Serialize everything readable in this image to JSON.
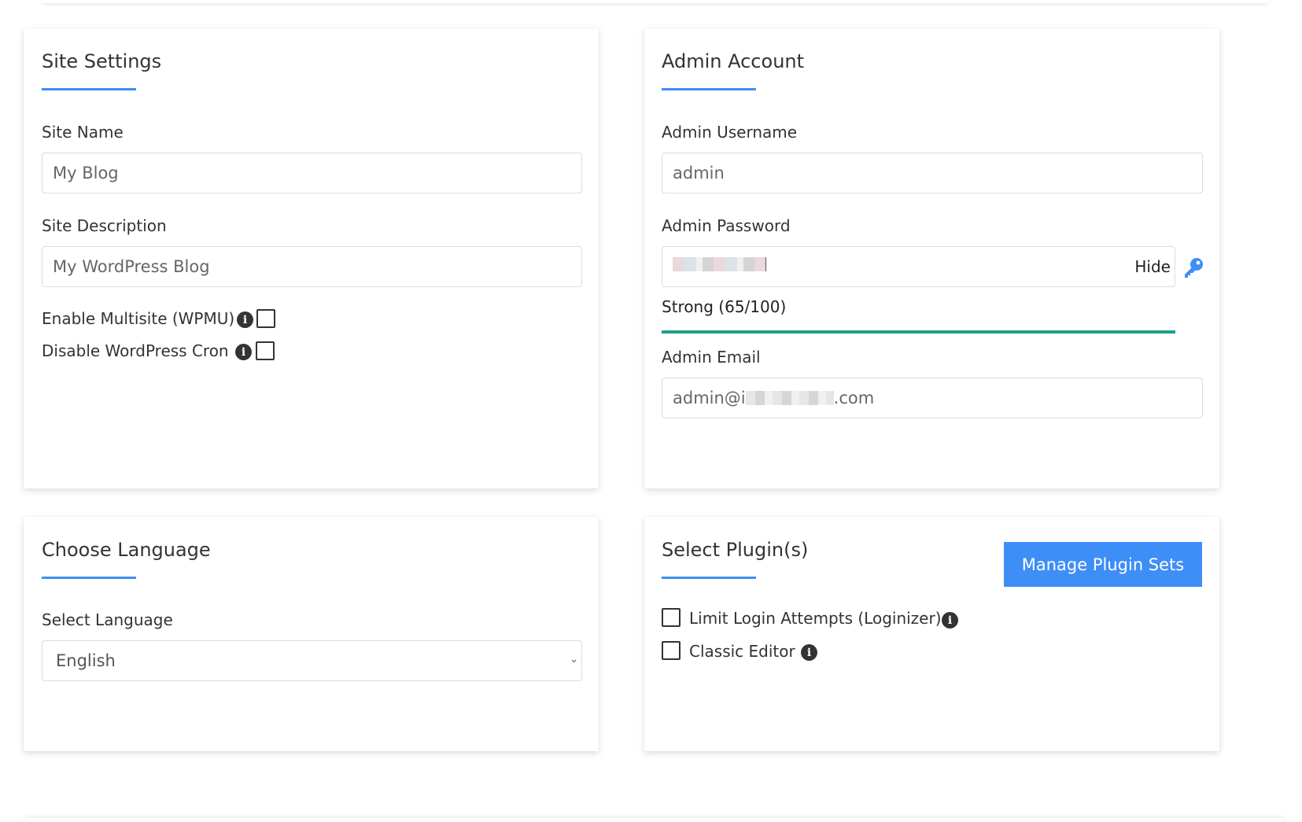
{
  "site_settings": {
    "title": "Site Settings",
    "site_name_label": "Site Name",
    "site_name_value": "My Blog",
    "site_description_label": "Site Description",
    "site_description_value": "My WordPress Blog",
    "enable_multisite_label": "Enable Multisite (WPMU)",
    "enable_multisite_checked": false,
    "disable_cron_label": "Disable WordPress Cron",
    "disable_cron_checked": false
  },
  "admin_account": {
    "title": "Admin Account",
    "username_label": "Admin Username",
    "username_value": "admin",
    "password_label": "Admin Password",
    "password_toggle_label": "Hide",
    "strength_text": "Strong (65/100)",
    "strength_score": 65,
    "email_label": "Admin Email",
    "email_prefix": "admin@i",
    "email_suffix": ".com"
  },
  "choose_language": {
    "title": "Choose Language",
    "select_label": "Select Language",
    "selected_value": "English"
  },
  "select_plugins": {
    "title": "Select Plugin(s)",
    "manage_button_label": "Manage Plugin Sets",
    "plugins": [
      {
        "label": "Limit Login Attempts (Loginizer)",
        "checked": false
      },
      {
        "label": "Classic Editor",
        "checked": false
      }
    ]
  },
  "icons": {
    "info": "info-icon",
    "key": "key-icon",
    "dropdown": "chevron-down-icon"
  },
  "colors": {
    "accent": "#3e8ef7",
    "strength_bar": "#1f9e8e"
  }
}
